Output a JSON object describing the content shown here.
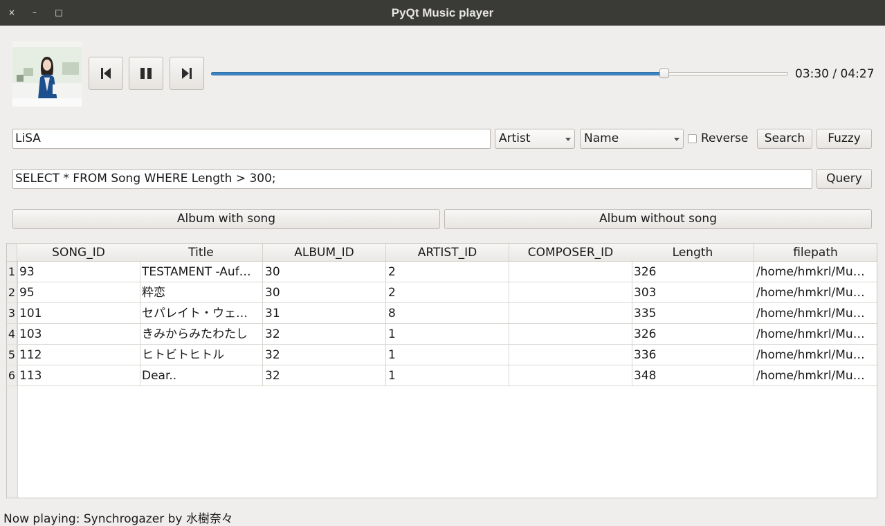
{
  "window": {
    "title": "PyQt Music player",
    "close": "×",
    "minimize": "–",
    "maximize": "□"
  },
  "player": {
    "time_display": "03:30 / 04:27",
    "progress_fraction": 0.785,
    "accent_color": "#3d85c6"
  },
  "search": {
    "query_value": "LiSA",
    "field_combo": "Artist",
    "sort_combo": "Name",
    "reverse_label": "Reverse",
    "reverse_checked": false,
    "search_label": "Search",
    "fuzzy_label": "Fuzzy"
  },
  "sql": {
    "value": "SELECT * FROM Song WHERE Length > 300;",
    "query_label": "Query"
  },
  "album": {
    "with_song_label": "Album with song",
    "without_song_label": "Album without song"
  },
  "table": {
    "columns": [
      "SONG_ID",
      "Title",
      "ALBUM_ID",
      "ARTIST_ID",
      "COMPOSER_ID",
      "Length",
      "filepath"
    ],
    "rows": [
      {
        "num": "1",
        "cells": [
          "93",
          "TESTAMENT -Auf…",
          "30",
          "2",
          "",
          "326",
          "/home/hmkrl/Mu…"
        ]
      },
      {
        "num": "2",
        "cells": [
          "95",
          "粋恋",
          "30",
          "2",
          "",
          "303",
          "/home/hmkrl/Mu…"
        ]
      },
      {
        "num": "3",
        "cells": [
          "101",
          "セパレイト・ウェ…",
          "31",
          "8",
          "",
          "335",
          "/home/hmkrl/Mu…"
        ]
      },
      {
        "num": "4",
        "cells": [
          "103",
          "きみからみたわたし",
          "32",
          "1",
          "",
          "326",
          "/home/hmkrl/Mu…"
        ]
      },
      {
        "num": "5",
        "cells": [
          "112",
          "ヒトビトヒトル",
          "32",
          "1",
          "",
          "336",
          "/home/hmkrl/Mu…"
        ]
      },
      {
        "num": "6",
        "cells": [
          "113",
          "Dear..",
          "32",
          "1",
          "",
          "348",
          "/home/hmkrl/Mu…"
        ]
      }
    ]
  },
  "status": {
    "text": "Now playing: Synchrogazer by 水樹奈々"
  }
}
